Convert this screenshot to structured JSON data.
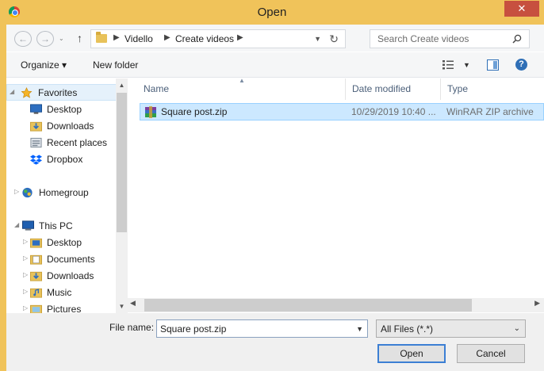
{
  "window": {
    "title": "Open",
    "close_label": "✕"
  },
  "nav": {
    "back_label": "←",
    "forward_label": "→",
    "recent_label": "⌄",
    "up_label": "↑",
    "breadcrumb": [
      "Vidello",
      "Create videos"
    ],
    "search_placeholder": "Search Create videos"
  },
  "toolbar": {
    "organize_label": "Organize ▾",
    "new_folder_label": "New folder"
  },
  "sidebar": {
    "favorites": {
      "label": "Favorites",
      "icon": "star-icon"
    },
    "favorites_items": [
      {
        "label": "Desktop",
        "icon": "desktop-icon"
      },
      {
        "label": "Downloads",
        "icon": "downloads-icon"
      },
      {
        "label": "Recent places",
        "icon": "recent-places-icon"
      },
      {
        "label": "Dropbox",
        "icon": "dropbox-icon"
      }
    ],
    "homegroup": {
      "label": "Homegroup",
      "icon": "homegroup-icon"
    },
    "this_pc": {
      "label": "This PC",
      "icon": "computer-icon"
    },
    "pc_items": [
      {
        "label": "Desktop",
        "icon": "folder-icon"
      },
      {
        "label": "Documents",
        "icon": "folder-icon"
      },
      {
        "label": "Downloads",
        "icon": "folder-icon"
      },
      {
        "label": "Music",
        "icon": "folder-icon"
      },
      {
        "label": "Pictures",
        "icon": "folder-icon"
      }
    ]
  },
  "files": {
    "columns": [
      "Name",
      "Date modified",
      "Type"
    ],
    "rows": [
      {
        "name": "Square post.zip",
        "date": "10/29/2019 10:40 ...",
        "type": "WinRAR ZIP archive",
        "icon": "winrar-zip-icon"
      }
    ]
  },
  "bottom": {
    "file_name_label": "File name:",
    "file_name_value": "Square post.zip",
    "filter_value": "All Files (*.*)",
    "open_label": "Open",
    "cancel_label": "Cancel"
  },
  "colors": {
    "frame": "#f0c35a",
    "close": "#c7503f",
    "selection": "#cce8ff",
    "accent": "#3c7fd4"
  }
}
